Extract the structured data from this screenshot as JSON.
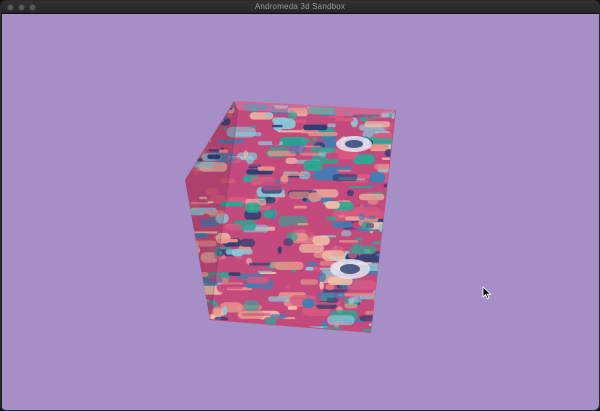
{
  "window": {
    "title": "Andromeda 3d Sandbox"
  },
  "viewport": {
    "background_color": "#a58fc6"
  },
  "scene": {
    "object": "textured-cube",
    "texture_palette": [
      "#d9597f",
      "#3f7fb5",
      "#2aa893",
      "#e8928a",
      "#2b3f73",
      "#c44a7d",
      "#8bc7d8",
      "#f0c0a8"
    ]
  },
  "icons": {
    "close": "close-traffic-light-icon",
    "minimize": "minimize-traffic-light-icon",
    "maximize": "maximize-traffic-light-icon",
    "cursor": "arrow-cursor-icon"
  }
}
